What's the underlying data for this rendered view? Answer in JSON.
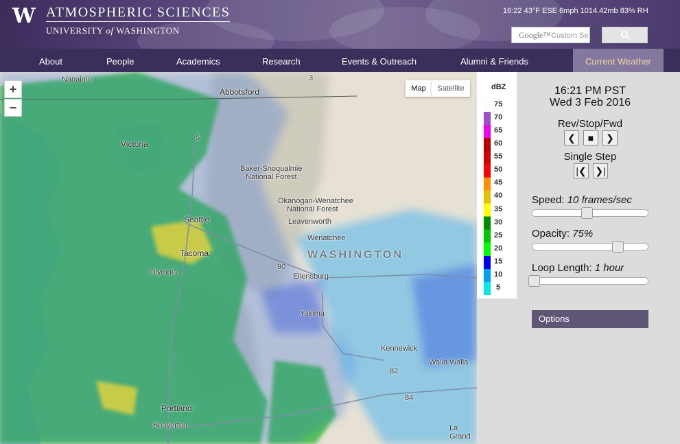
{
  "header": {
    "logo_letter": "W",
    "title": "ATMOSPHERIC SCIENCES",
    "subtitle_left": "UNIVERSITY",
    "subtitle_of": "of",
    "subtitle_right": "WASHINGTON",
    "weather_readout": "16:22 43°F ESE 6mph 1014.42mb 83% RH",
    "search_brand": "Google™",
    "search_placeholder": "Custom Se"
  },
  "nav": {
    "items": [
      "About",
      "People",
      "Academics",
      "Research",
      "Events & Outreach",
      "Alumni & Friends",
      "Current Weather"
    ],
    "active": "Current Weather"
  },
  "map": {
    "zoom_in": "+",
    "zoom_out": "−",
    "type_map": "Map",
    "type_satellite": "Satellite",
    "labels": {
      "victoria": "Victoria",
      "abbotsford": "Abbotsford",
      "nanaimo": "Nanaimo",
      "seattle": "Seattle",
      "tacoma": "Tacoma",
      "olympia": "Olympia",
      "washington": "WASHINGTON",
      "leavenworth": "Leavenworth",
      "wenatchee": "Wenatchee",
      "ellensburg": "Ellensburg",
      "yakima": "Yakima",
      "kennewick": "Kennewick",
      "walla_walla": "Walla Walla",
      "portland": "Portland",
      "beaverton": "Beaverton",
      "la_grande": "La Grand",
      "forest1": "Baker-Snoqualmie",
      "forest1b": "National Forest",
      "forest2": "Okanogan-Wenatchee",
      "forest2b": "National Forest",
      "hwy_5": "5",
      "hwy_90": "90",
      "hwy_82": "82",
      "hwy_84": "84",
      "hwy_3": "3"
    }
  },
  "scale": {
    "unit": "dBZ",
    "labels": [
      "75",
      "70",
      "65",
      "60",
      "55",
      "50",
      "45",
      "40",
      "35",
      "30",
      "25",
      "20",
      "15",
      "10",
      "5"
    ],
    "colors": [
      "#fdfdfd",
      "#9e4fc8",
      "#f200f2",
      "#b80000",
      "#d40000",
      "#ff0000",
      "#ff9000",
      "#e7c000",
      "#ffff00",
      "#008e00",
      "#00c800",
      "#00ff00",
      "#0000f6",
      "#01a0f6",
      "#04e9e7"
    ]
  },
  "panel": {
    "time": "16:21 PM PST",
    "date": "Wed 3 Feb 2016",
    "rev_title": "Rev/Stop/Fwd",
    "single_title": "Single Step",
    "speed_label": "Speed:",
    "speed_value": "10 frames/sec",
    "speed_level": 0.47,
    "opacity_label": "Opacity:",
    "opacity_value": "75%",
    "opacity_level": 0.75,
    "loop_label": "Loop Length:",
    "loop_value": "1 hour",
    "loop_level": 0.0,
    "options_label": "Options"
  },
  "colors": {
    "uw_purple": "#3b2e5a",
    "nav_active_bg": "#85789e",
    "nav_active_text": "#f0d9a0",
    "options_bg": "#5f5676"
  }
}
